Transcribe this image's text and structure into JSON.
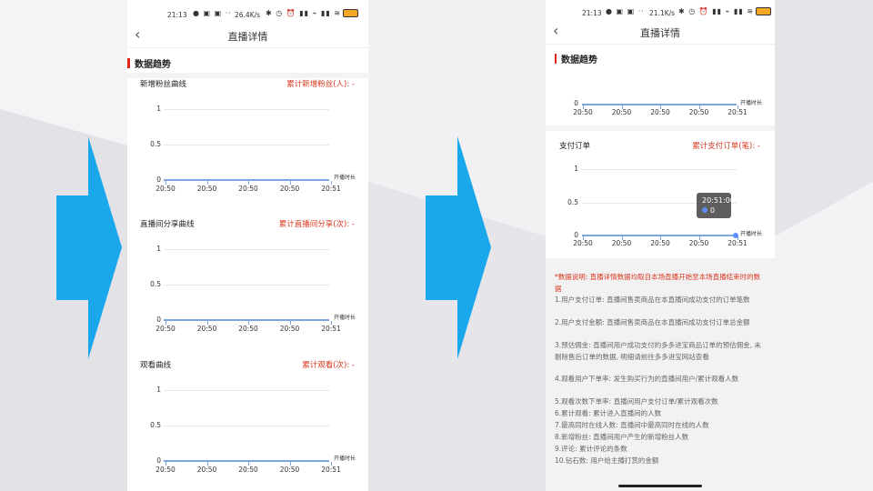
{
  "colors": {
    "accent_red": "#d9371f",
    "section_bar": "#e2231a",
    "line_blue": "#7ea7e2",
    "arrow_blue": "#1aa7ec"
  },
  "left_phone": {
    "status": {
      "time": "21:13",
      "speed": "26.4K/s",
      "battery": "86"
    },
    "nav": {
      "title": "直播详情"
    },
    "section_title": "数据趋势",
    "charts": [
      {
        "title": "新增粉丝曲线",
        "total": "累计新增粉丝(人): -",
        "chart_data": {
          "type": "line",
          "x": [
            "20:50",
            "20:50",
            "20:50",
            "20:50",
            "20:51"
          ],
          "ylim": [
            0,
            1
          ],
          "yticks": [
            "0",
            "0.5",
            "1"
          ],
          "xlabel": "开播时长",
          "values": [
            0,
            0,
            0,
            0,
            0
          ]
        }
      },
      {
        "title": "直播间分享曲线",
        "total": "累计直播间分享(次): -",
        "chart_data": {
          "type": "line",
          "x": [
            "20:50",
            "20:50",
            "20:50",
            "20:50",
            "20:51"
          ],
          "ylim": [
            0,
            1
          ],
          "yticks": [
            "0",
            "0.5",
            "1"
          ],
          "xlabel": "开播时长",
          "values": [
            0,
            0,
            0,
            0,
            0
          ]
        }
      },
      {
        "title": "观看曲线",
        "total": "累计观看(次): -",
        "chart_data": {
          "type": "line",
          "x": [
            "20:50",
            "20:50",
            "20:50",
            "20:50",
            "20:51"
          ],
          "ylim": [
            0,
            1
          ],
          "yticks": [
            "0",
            "0.5",
            "1"
          ],
          "xlabel": "开播时长",
          "values": [
            0,
            0,
            0,
            0,
            0
          ]
        }
      }
    ]
  },
  "right_phone": {
    "status": {
      "time": "21:13",
      "speed": "21.1K/s",
      "battery": "86"
    },
    "nav": {
      "title": "直播详情"
    },
    "section_title": "数据趋势",
    "partial_chart": {
      "ytick": "0",
      "x": [
        "20:50",
        "20:50",
        "20:50",
        "20:50",
        "20:51"
      ],
      "xlabel": "开播时长"
    },
    "pay_chart": {
      "title": "支付订单",
      "total": "累计支付订单(笔): -",
      "chart_data": {
        "type": "line",
        "x": [
          "20:50",
          "20:50",
          "20:50",
          "20:50",
          "20:51"
        ],
        "ylim": [
          0,
          1
        ],
        "yticks": [
          "0",
          "0.5",
          "1"
        ],
        "xlabel": "开播时长",
        "values": [
          0,
          0,
          0,
          0,
          0
        ]
      },
      "tooltip": {
        "time": "20:51:00",
        "value": "0"
      }
    },
    "notes": {
      "title": "*数据说明: 直播详情数据均取自本场直播开始至本场直播结束时的数据",
      "items": [
        "1.用户支付订单: 直播间售卖商品在本直播间成功支付的订单笔数",
        "2.用户支付金额: 直播间售卖商品在本直播间成功支付订单总金额",
        "3.预估佣金: 直播间用户成功支付的多多进宝商品订单的预估佣金, 未剔除售后订单的数据, 明细请前往多多进宝网站查看",
        "4.观看用户下单率: 发生购买行为的直播间用户/累计观看人数",
        "5.观看次数下单率: 直播间用户支付订单/累计观看次数",
        "6.累计观看: 累计进入直播间的人数",
        "7.最高同时在线人数: 直播间中最高同时在线的人数",
        "8.新增粉丝: 直播间用户产生的新增粉丝人数",
        "9.评论: 累计评论的条数",
        "10.钻石数: 用户给主播打赏的金额"
      ]
    }
  }
}
